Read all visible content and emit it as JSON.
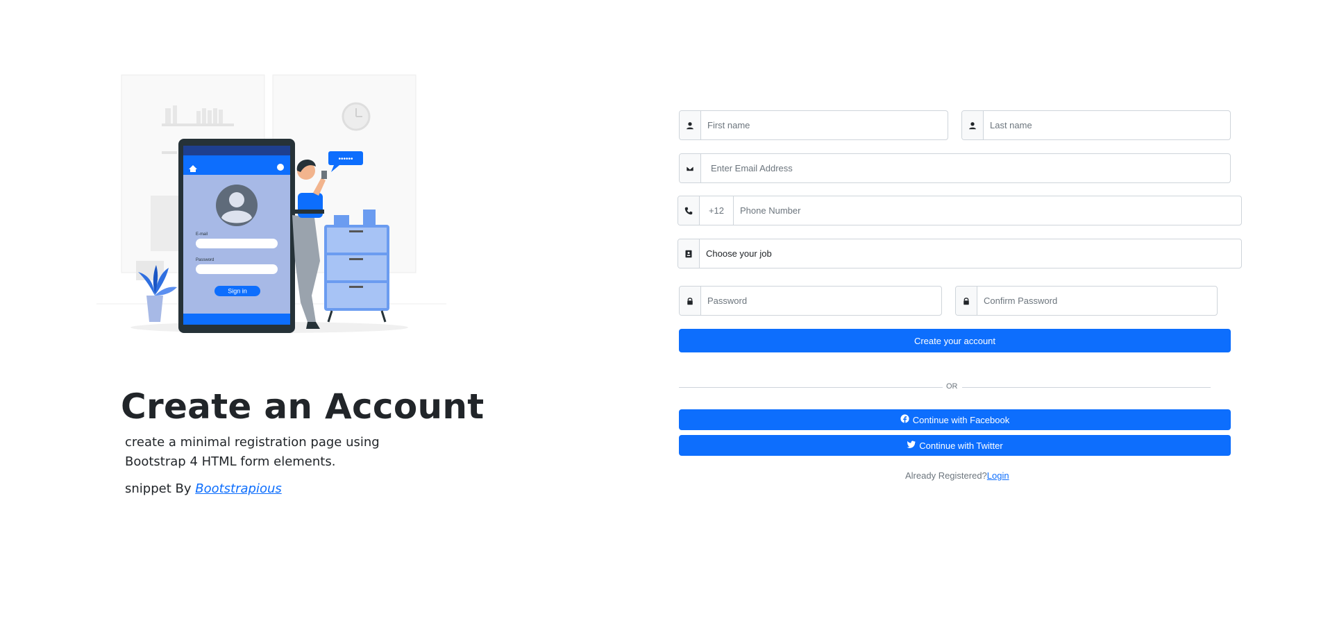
{
  "hero": {
    "title": "Create an Account",
    "description": "create a minimal registration page using Bootstrap 4 HTML form elements.",
    "credit_prefix": "snippet By ",
    "credit_link": "Bootstrapious",
    "illustration": {
      "phone_email_label": "E-mail",
      "phone_password_label": "Password",
      "phone_signin_label": "Sign in"
    }
  },
  "form": {
    "first_name": {
      "placeholder": "First name",
      "icon": "user-icon"
    },
    "last_name": {
      "placeholder": "Last name",
      "icon": "user-icon"
    },
    "email": {
      "placeholder": "Enter Email Address",
      "icon": "envelope-icon"
    },
    "phone": {
      "country_code": "+12",
      "placeholder": "Phone Number",
      "icon": "phone-icon"
    },
    "job": {
      "selected": "Choose your job",
      "icon": "id-card-icon"
    },
    "password": {
      "placeholder": "Password",
      "icon": "lock-icon"
    },
    "confirm_password": {
      "placeholder": "Confirm Password",
      "icon": "lock-icon"
    },
    "submit_label": "Create your account",
    "divider_text": "OR",
    "facebook_label": "Continue with Facebook",
    "twitter_label": "Continue with Twitter",
    "already_text": "Already Registered?",
    "login_link": "Login"
  },
  "colors": {
    "primary": "#0d6efd",
    "text": "#212529",
    "muted": "#6c757d",
    "border": "#ced4da",
    "illustration_light_blue": "#a7b9e6"
  }
}
